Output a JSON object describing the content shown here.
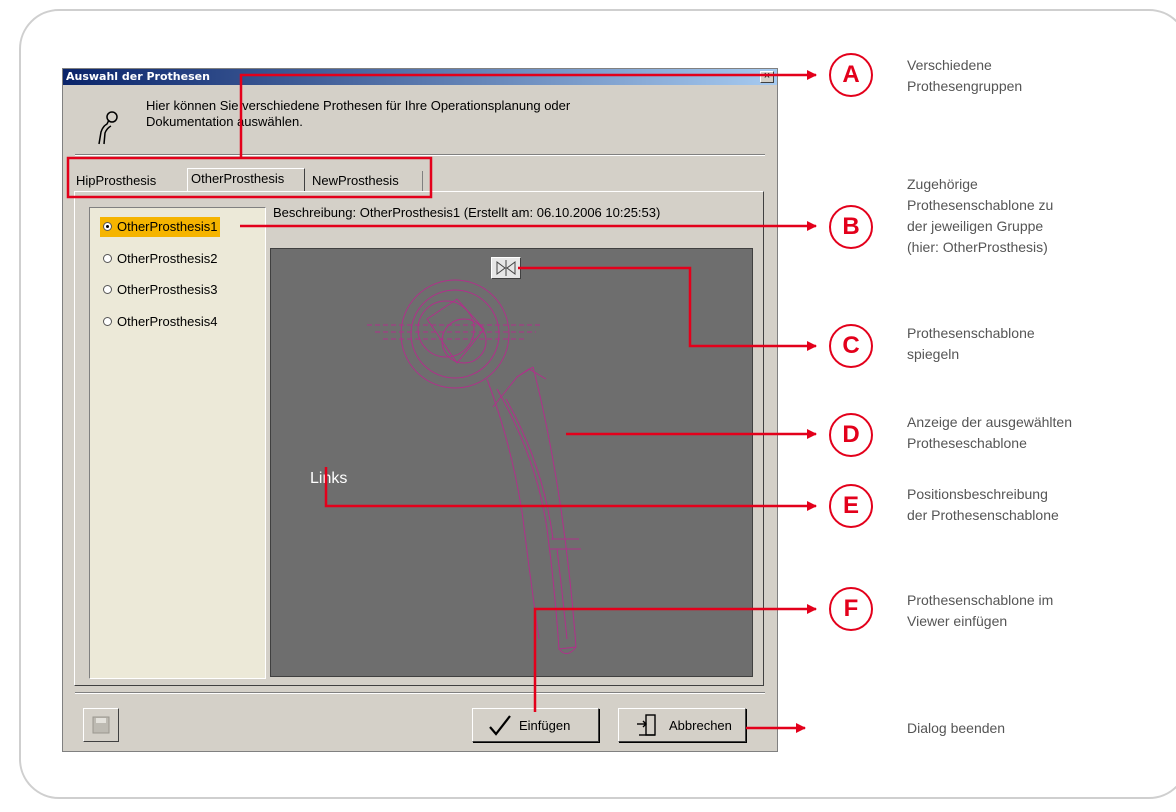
{
  "dialog": {
    "title": "Auswahl der Prothesen",
    "close_glyph": "×",
    "header_line1": "Hier können Sie verschiedene Prothesen für Ihre Operationsplanung oder",
    "header_line2": "Dokumentation auswählen.",
    "header_icon": "prosthesis-icon",
    "tabs": [
      {
        "label": "HipProsthesis"
      },
      {
        "label": "OtherProsthesis",
        "active": true
      },
      {
        "label": "NewProsthesis"
      }
    ],
    "items": [
      {
        "label": "OtherProsthesis1",
        "selected": true
      },
      {
        "label": "OtherProsthesis2"
      },
      {
        "label": "OtherProsthesis3"
      },
      {
        "label": "OtherProsthesis4"
      }
    ],
    "description": "Beschreibung: OtherProsthesis1 (Erstellt am: 06.10.2006 10:25:53)",
    "viewer": {
      "position_label": "Links",
      "mirror_icon": "mirror-icon"
    },
    "buttons": {
      "insert": "Einfügen",
      "cancel": "Abbrechen",
      "save_icon": "save-disk-icon"
    }
  },
  "annotations": [
    {
      "letter": "A",
      "line1": "Verschiedene",
      "line2": "Prothesengruppen"
    },
    {
      "letter": "B",
      "line1": "Zugehörige",
      "line2": "Prothesenschablone zu",
      "line3": "der jeweiligen Gruppe",
      "line4": "(hier: OtherProsthesis)"
    },
    {
      "letter": "C",
      "line1": "Prothesenschablone",
      "line2": "spiegeln"
    },
    {
      "letter": "D",
      "line1": "Anzeige der ausgewählten",
      "line2": "Protheseschablone"
    },
    {
      "letter": "E",
      "line1": "Positionsbeschreibung",
      "line2": "der Prothesenschablone"
    },
    {
      "letter": "F",
      "line1": "Prothesenschablone im",
      "line2": "Viewer einfügen"
    },
    {
      "line1": "Dialog beenden"
    }
  ],
  "colors": {
    "accent": "#e3001b",
    "highlight": "#f5b400",
    "viewer_bg": "#6e6e6e",
    "template_stroke": "#b0308a"
  }
}
